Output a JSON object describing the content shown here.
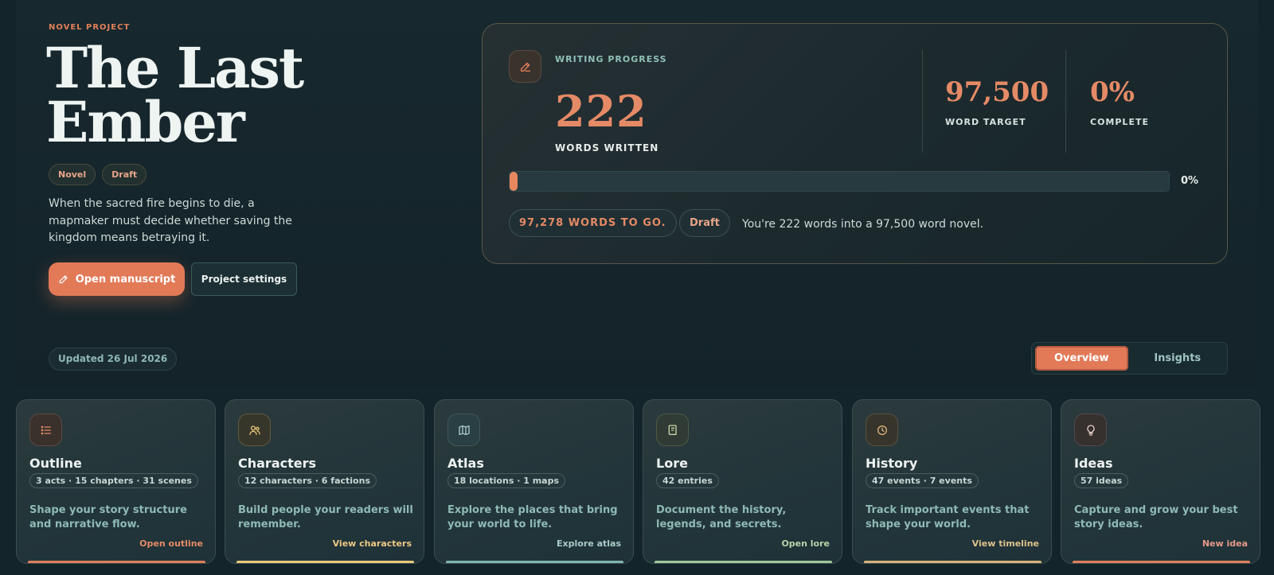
{
  "header": {
    "eyebrow": "NOVEL PROJECT",
    "title_line1": "The Last",
    "title_line2": "Ember",
    "tags": [
      "Novel",
      "Draft"
    ],
    "blurb": "When the sacred fire begins to die, a mapmaker must decide whether saving the kingdom means betraying it.",
    "open_manuscript": "Open manuscript",
    "project_settings": "Project settings",
    "updated": "Updated 26 Jul 2026"
  },
  "progress": {
    "label": "WRITING PROGRESS",
    "words_written": "222",
    "words_written_label": "WORDS WRITTEN",
    "target": "97,500",
    "target_label": "WORD TARGET",
    "complete": "0%",
    "complete_label": "COMPLETE",
    "bar_fraction": 0.0023,
    "bar_pct_label": "0%",
    "words_to_go": "97,278 WORDS TO GO.",
    "status": "Draft",
    "note": "You're 222 words into a 97,500 word novel."
  },
  "tabs": [
    {
      "label": "Overview",
      "active": true
    },
    {
      "label": "Insights",
      "active": false
    }
  ],
  "cards": [
    {
      "key": "outline",
      "icon": "list-icon",
      "title": "Outline",
      "meta": "3 acts · 15 chapters · 31 scenes",
      "desc": "Shape your story structure and narrative flow.",
      "link": "Open outline",
      "accent": "#e07e5c",
      "link_color": "#e58a66",
      "icon_color": "#e08a66"
    },
    {
      "key": "characters",
      "icon": "users-icon",
      "title": "Characters",
      "meta": "12 characters · 6 factions",
      "desc": "Build people your readers will remember.",
      "link": "View characters",
      "accent": "#e7c77a",
      "link_color": "#ecc884",
      "icon_color": "#e7c77a"
    },
    {
      "key": "atlas",
      "icon": "map-icon",
      "title": "Atlas",
      "meta": "18 locations · 1 maps",
      "desc": "Explore the places that bring your world to life.",
      "link": "Explore atlas",
      "accent": "#7fb5b0",
      "link_color": "#a8cbc6",
      "icon_color": "#a8cbc6"
    },
    {
      "key": "lore",
      "icon": "book-icon",
      "title": "Lore",
      "meta": "42 entries",
      "desc": "Document the history, legends, and secrets.",
      "link": "Open lore",
      "accent": "#9fc79c",
      "link_color": "#b5d3a8",
      "icon_color": "#c8d6a8"
    },
    {
      "key": "history",
      "icon": "clock-icon",
      "title": "History",
      "meta": "47 events · 7 events",
      "desc": "Track important events that shape your world.",
      "link": "View timeline",
      "accent": "#d7b27a",
      "link_color": "#ddc08c",
      "icon_color": "#ddb27a"
    },
    {
      "key": "ideas",
      "icon": "lightbulb-icon",
      "title": "Ideas",
      "meta": "57 ideas",
      "desc": "Capture and grow your best story ideas.",
      "link": "New idea",
      "accent": "#e07e5c",
      "link_color": "#e59a86",
      "icon_color": "#e5cfc4"
    }
  ]
}
